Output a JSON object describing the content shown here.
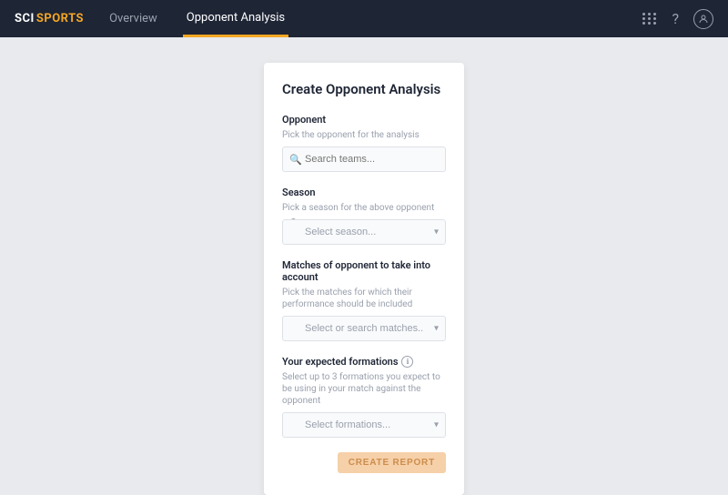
{
  "navbar": {
    "logo_sci": "SCI",
    "logo_sports": "SPORTS",
    "nav_items": [
      {
        "label": "Overview",
        "active": false
      },
      {
        "label": "Opponent Analysis",
        "active": true
      }
    ],
    "icons": {
      "grid": "grid-icon",
      "help": "help-icon",
      "user": "user-icon"
    }
  },
  "form": {
    "title": "Create Opponent Analysis",
    "sections": {
      "opponent": {
        "label": "Opponent",
        "hint": "Pick the opponent for the analysis",
        "placeholder": "Search teams..."
      },
      "season": {
        "label": "Season",
        "hint": "Pick a season for the above opponent",
        "placeholder": "Select season..."
      },
      "matches": {
        "label": "Matches of opponent to take into account",
        "hint": "Pick the matches for which their performance should be included",
        "placeholder": "Select or search matches..."
      },
      "formations": {
        "label": "Your expected formations",
        "info": "ℹ",
        "hint": "Select up to 3 formations you expect to be using in your match against the opponent",
        "placeholder": "Select formations..."
      }
    },
    "create_button": "CREATE REPORT"
  }
}
